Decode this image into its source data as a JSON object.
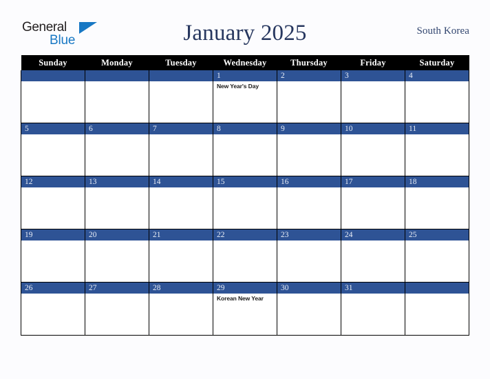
{
  "brand": {
    "name_part1": "General",
    "name_part2": "Blue",
    "triangle_color": "#1878c4",
    "text_color": "#231f20"
  },
  "header": {
    "title": "January 2025",
    "country": "South Korea",
    "title_color": "#27375f"
  },
  "colors": {
    "page_background": "#fcfcfe",
    "weekday_header_background": "#000000",
    "weekday_header_text": "#ffffff",
    "day_band_background": "#2e5395",
    "day_band_text": "#e9eef7",
    "cell_background": "#ffffff",
    "grid_line": "#000000",
    "event_text": "#1a1a1a"
  },
  "weekdays": [
    "Sunday",
    "Monday",
    "Tuesday",
    "Wednesday",
    "Thursday",
    "Friday",
    "Saturday"
  ],
  "weeks": [
    [
      {
        "day": "",
        "events": []
      },
      {
        "day": "",
        "events": []
      },
      {
        "day": "",
        "events": []
      },
      {
        "day": "1",
        "events": [
          "New Year's Day"
        ]
      },
      {
        "day": "2",
        "events": []
      },
      {
        "day": "3",
        "events": []
      },
      {
        "day": "4",
        "events": []
      }
    ],
    [
      {
        "day": "5",
        "events": []
      },
      {
        "day": "6",
        "events": []
      },
      {
        "day": "7",
        "events": []
      },
      {
        "day": "8",
        "events": []
      },
      {
        "day": "9",
        "events": []
      },
      {
        "day": "10",
        "events": []
      },
      {
        "day": "11",
        "events": []
      }
    ],
    [
      {
        "day": "12",
        "events": []
      },
      {
        "day": "13",
        "events": []
      },
      {
        "day": "14",
        "events": []
      },
      {
        "day": "15",
        "events": []
      },
      {
        "day": "16",
        "events": []
      },
      {
        "day": "17",
        "events": []
      },
      {
        "day": "18",
        "events": []
      }
    ],
    [
      {
        "day": "19",
        "events": []
      },
      {
        "day": "20",
        "events": []
      },
      {
        "day": "21",
        "events": []
      },
      {
        "day": "22",
        "events": []
      },
      {
        "day": "23",
        "events": []
      },
      {
        "day": "24",
        "events": []
      },
      {
        "day": "25",
        "events": []
      }
    ],
    [
      {
        "day": "26",
        "events": []
      },
      {
        "day": "27",
        "events": []
      },
      {
        "day": "28",
        "events": []
      },
      {
        "day": "29",
        "events": [
          "Korean New Year"
        ]
      },
      {
        "day": "30",
        "events": []
      },
      {
        "day": "31",
        "events": []
      },
      {
        "day": "",
        "events": []
      }
    ]
  ]
}
